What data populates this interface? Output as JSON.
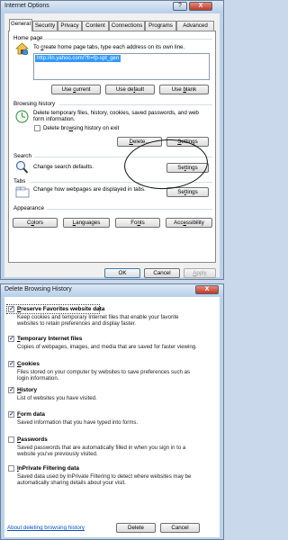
{
  "internet_options": {
    "title": "Internet Options",
    "help_glyph": "?",
    "close_glyph": "X",
    "tabs": [
      "General",
      "Security",
      "Privacy",
      "Content",
      "Connections",
      "Programs",
      "Advanced"
    ],
    "home_page": {
      "group_label": "Home page",
      "description_pre": "To ",
      "description_accel": "c",
      "description_post": "reate home page tabs, type each address on its own line.",
      "url": "http://in.yahoo.com/?fr=fp-spt_gen",
      "buttons": [
        {
          "pre": "Use ",
          "accel": "c",
          "post": "urrent"
        },
        {
          "pre": "Use de",
          "accel": "f",
          "post": "ault"
        },
        {
          "pre": "Use ",
          "accel": "b",
          "post": "lank"
        }
      ]
    },
    "browsing_history": {
      "group_label": "Browsing history",
      "description": "Delete temporary files, history, cookies, saved passwords, and web form information.",
      "checkbox_pre": "Delete bro",
      "checkbox_accel": "w",
      "checkbox_post": "sing history on exit",
      "delete_pre": "",
      "delete_accel": "D",
      "delete_post": "elete...",
      "settings_pre": "",
      "settings_accel": "S",
      "settings_post": "ettings"
    },
    "search": {
      "group_label": "Search",
      "description": "Change search defaults.",
      "settings_pre": "Se",
      "settings_accel": "t",
      "settings_post": "tings"
    },
    "tabs_group": {
      "group_label": "Tabs",
      "description": "Change how webpages are displayed in tabs.",
      "settings_pre": "Se",
      "settings_accel": "t",
      "settings_post": "tings"
    },
    "appearance": {
      "group_label": "Appearance",
      "buttons": [
        {
          "pre": "C",
          "accel": "o",
          "post": "lors"
        },
        {
          "pre": "",
          "accel": "L",
          "post": "anguages"
        },
        {
          "pre": "Fo",
          "accel": "n",
          "post": "ts"
        },
        {
          "pre": "Acc",
          "accel": "e",
          "post": "ssibility"
        }
      ]
    },
    "footer": {
      "ok": "OK",
      "cancel": "Cancel",
      "apply_pre": "",
      "apply_accel": "A",
      "apply_post": "pply"
    }
  },
  "delete_history": {
    "title": "Delete Browsing History",
    "close_glyph": "X",
    "items": [
      {
        "checked": true,
        "title_pre": "",
        "title_accel": "P",
        "title_post": "reserve Favorites website data",
        "desc": "Keep cookies and temporary Internet files that enable your favorite websites to retain preferences and display faster."
      },
      {
        "checked": true,
        "title_pre": "",
        "title_accel": "T",
        "title_post": "emporary Internet files",
        "desc": "Copies of webpages, images, and media that are saved for faster viewing."
      },
      {
        "checked": true,
        "title_pre": "",
        "title_accel": "C",
        "title_post": "ookies",
        "desc": "Files stored on your computer by websites to save preferences such as login information."
      },
      {
        "checked": true,
        "title_pre": "",
        "title_accel": "H",
        "title_post": "istory",
        "desc": "List of websites you have visited."
      },
      {
        "checked": true,
        "title_pre": "",
        "title_accel": "F",
        "title_post": "orm data",
        "desc": "Saved information that you have typed into forms."
      },
      {
        "checked": false,
        "title_pre": "",
        "title_accel": "P",
        "title_post": "asswords",
        "desc": "Saved passwords that are automatically filled in when you sign in to a website you've previously visited."
      },
      {
        "checked": false,
        "title_pre": "",
        "title_accel": "I",
        "title_post": "nPrivate Filtering data",
        "desc": "Saved data used by InPrivate Filtering to detect where websites may be automatically sharing details about your visit."
      }
    ],
    "link": "About deleting browsing history",
    "delete_button": "Delete",
    "cancel_button": "Cancel"
  }
}
